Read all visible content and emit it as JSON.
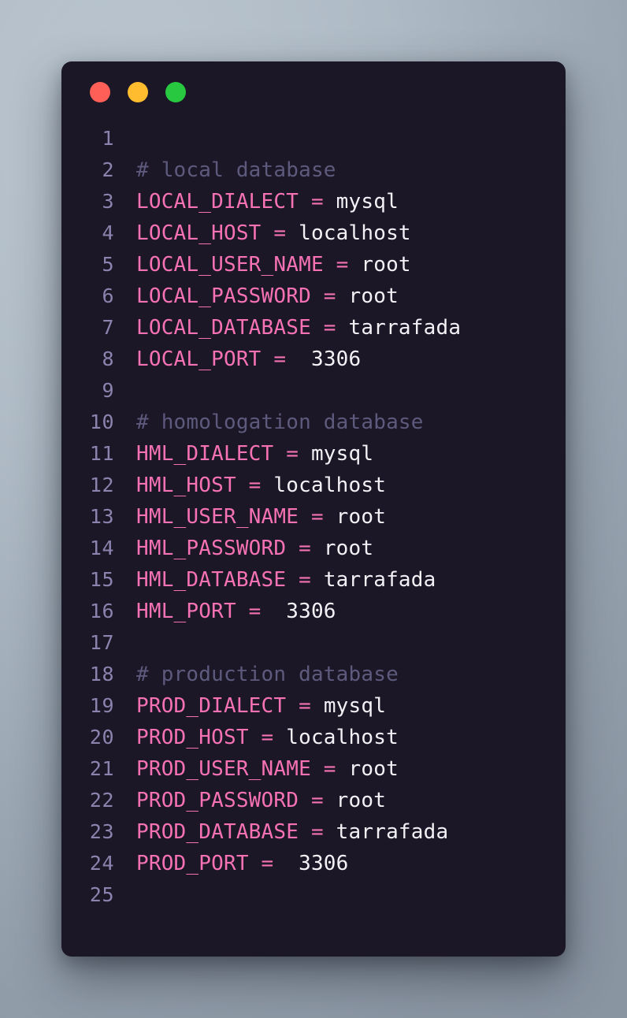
{
  "window": {
    "background_color": "#1b1726",
    "traffic_lights": [
      {
        "name": "close-button",
        "color": "#ff5f57"
      },
      {
        "name": "minimize-button",
        "color": "#febc2e"
      },
      {
        "name": "maximize-button",
        "color": "#28c840"
      }
    ]
  },
  "theme": {
    "comment_color": "#5e5a7d",
    "key_color": "#f672b4",
    "operator_color": "#f672b4",
    "value_color": "#f2f1f6",
    "gutter_color": "#8b84ae",
    "page_background": "#a4b0bc"
  },
  "editor": {
    "language": "dotenv",
    "total_lines": 25,
    "lines": [
      {
        "number": "1",
        "tokens": []
      },
      {
        "number": "2",
        "tokens": [
          {
            "type": "comment",
            "text": "# local database"
          }
        ]
      },
      {
        "number": "3",
        "tokens": [
          {
            "type": "key",
            "text": "LOCAL_DIALECT"
          },
          {
            "type": "op",
            "text": " = "
          },
          {
            "type": "val",
            "text": "mysql"
          }
        ]
      },
      {
        "number": "4",
        "tokens": [
          {
            "type": "key",
            "text": "LOCAL_HOST"
          },
          {
            "type": "op",
            "text": " = "
          },
          {
            "type": "val",
            "text": "localhost"
          }
        ]
      },
      {
        "number": "5",
        "tokens": [
          {
            "type": "key",
            "text": "LOCAL_USER_NAME"
          },
          {
            "type": "op",
            "text": " = "
          },
          {
            "type": "val",
            "text": "root"
          }
        ]
      },
      {
        "number": "6",
        "tokens": [
          {
            "type": "key",
            "text": "LOCAL_PASSWORD"
          },
          {
            "type": "op",
            "text": " = "
          },
          {
            "type": "val",
            "text": "root"
          }
        ]
      },
      {
        "number": "7",
        "tokens": [
          {
            "type": "key",
            "text": "LOCAL_DATABASE"
          },
          {
            "type": "op",
            "text": " = "
          },
          {
            "type": "val",
            "text": "tarrafada"
          }
        ]
      },
      {
        "number": "8",
        "tokens": [
          {
            "type": "key",
            "text": "LOCAL_PORT"
          },
          {
            "type": "op",
            "text": " = "
          },
          {
            "type": "val",
            "text": " 3306"
          }
        ]
      },
      {
        "number": "9",
        "tokens": []
      },
      {
        "number": "10",
        "tokens": [
          {
            "type": "comment",
            "text": "# homologation database"
          }
        ]
      },
      {
        "number": "11",
        "tokens": [
          {
            "type": "key",
            "text": "HML_DIALECT"
          },
          {
            "type": "op",
            "text": " = "
          },
          {
            "type": "val",
            "text": "mysql"
          }
        ]
      },
      {
        "number": "12",
        "tokens": [
          {
            "type": "key",
            "text": "HML_HOST"
          },
          {
            "type": "op",
            "text": " = "
          },
          {
            "type": "val",
            "text": "localhost"
          }
        ]
      },
      {
        "number": "13",
        "tokens": [
          {
            "type": "key",
            "text": "HML_USER_NAME"
          },
          {
            "type": "op",
            "text": " = "
          },
          {
            "type": "val",
            "text": "root"
          }
        ]
      },
      {
        "number": "14",
        "tokens": [
          {
            "type": "key",
            "text": "HML_PASSWORD"
          },
          {
            "type": "op",
            "text": " = "
          },
          {
            "type": "val",
            "text": "root"
          }
        ]
      },
      {
        "number": "15",
        "tokens": [
          {
            "type": "key",
            "text": "HML_DATABASE"
          },
          {
            "type": "op",
            "text": " = "
          },
          {
            "type": "val",
            "text": "tarrafada"
          }
        ]
      },
      {
        "number": "16",
        "tokens": [
          {
            "type": "key",
            "text": "HML_PORT"
          },
          {
            "type": "op",
            "text": " = "
          },
          {
            "type": "val",
            "text": " 3306"
          }
        ]
      },
      {
        "number": "17",
        "tokens": []
      },
      {
        "number": "18",
        "tokens": [
          {
            "type": "comment",
            "text": "# production database"
          }
        ]
      },
      {
        "number": "19",
        "tokens": [
          {
            "type": "key",
            "text": "PROD_DIALECT"
          },
          {
            "type": "op",
            "text": " = "
          },
          {
            "type": "val",
            "text": "mysql"
          }
        ]
      },
      {
        "number": "20",
        "tokens": [
          {
            "type": "key",
            "text": "PROD_HOST"
          },
          {
            "type": "op",
            "text": " = "
          },
          {
            "type": "val",
            "text": "localhost"
          }
        ]
      },
      {
        "number": "21",
        "tokens": [
          {
            "type": "key",
            "text": "PROD_USER_NAME"
          },
          {
            "type": "op",
            "text": " = "
          },
          {
            "type": "val",
            "text": "root"
          }
        ]
      },
      {
        "number": "22",
        "tokens": [
          {
            "type": "key",
            "text": "PROD_PASSWORD"
          },
          {
            "type": "op",
            "text": " = "
          },
          {
            "type": "val",
            "text": "root"
          }
        ]
      },
      {
        "number": "23",
        "tokens": [
          {
            "type": "key",
            "text": "PROD_DATABASE"
          },
          {
            "type": "op",
            "text": " = "
          },
          {
            "type": "val",
            "text": "tarrafada"
          }
        ]
      },
      {
        "number": "24",
        "tokens": [
          {
            "type": "key",
            "text": "PROD_PORT"
          },
          {
            "type": "op",
            "text": " = "
          },
          {
            "type": "val",
            "text": " 3306"
          }
        ]
      },
      {
        "number": "25",
        "tokens": []
      }
    ]
  }
}
